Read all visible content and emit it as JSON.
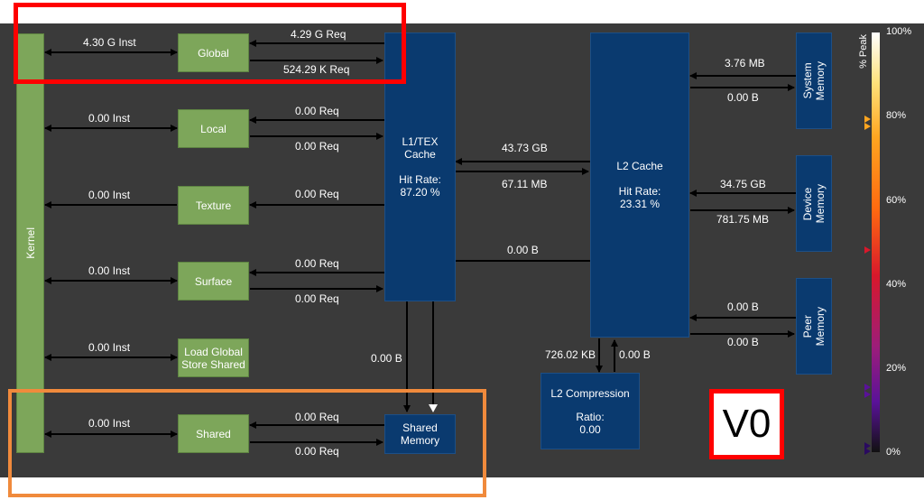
{
  "kernel": {
    "label": "Kernel"
  },
  "units": [
    {
      "key": "global",
      "label": "Global",
      "inst": "4.30 G Inst",
      "req_in": "4.29 G Req",
      "req_out": "524.29 K Req"
    },
    {
      "key": "local",
      "label": "Local",
      "inst": "0.00 Inst",
      "req_in": "0.00 Req",
      "req_out": "0.00 Req"
    },
    {
      "key": "texture",
      "label": "Texture",
      "inst": "0.00 Inst",
      "req_in": "0.00 Req"
    },
    {
      "key": "surface",
      "label": "Surface",
      "inst": "0.00 Inst",
      "req_in": "0.00 Req",
      "req_out": "0.00 Req"
    },
    {
      "key": "lgss",
      "label": "Load Global\nStore Shared",
      "inst": "0.00 Inst"
    },
    {
      "key": "shared",
      "label": "Shared",
      "inst": "0.00 Inst",
      "req_in": "0.00 Req",
      "req_out": "0.00 Req"
    }
  ],
  "l1": {
    "label": "L1/TEX\nCache",
    "hit_label": "Hit Rate:",
    "hit_rate": "87.20 %"
  },
  "shared_memory": {
    "label": "Shared\nMemory"
  },
  "l1_to_shared": "0.00 B",
  "l2": {
    "label": "L2 Cache",
    "hit_label": "Hit Rate:",
    "hit_rate": "23.31 %"
  },
  "l1_l2": {
    "read": "43.73 GB",
    "write": "67.11 MB",
    "l2_to_shared": "0.00 B"
  },
  "l2_compression": {
    "label": "L2 Compression",
    "ratio_label": "Ratio:",
    "ratio": "0.00",
    "in": "726.02 KB",
    "out": "0.00 B"
  },
  "system_memory": {
    "label": "System\nMemory",
    "read": "3.76 MB",
    "write": "0.00 B"
  },
  "device_memory": {
    "label": "Device\nMemory",
    "read": "34.75 GB",
    "write": "781.75 MB"
  },
  "peer_memory": {
    "label": "Peer\nMemory",
    "read": "0.00 B",
    "write": "0.00 B"
  },
  "scale": {
    "title": "% Peak",
    "ticks": [
      "100%",
      "80%",
      "60%",
      "40%",
      "20%",
      "0%"
    ]
  },
  "version_label": "V0",
  "colors": {
    "panel": "#3a3a3a",
    "unit_green": "#7da65a",
    "cache_blue": "#0a3a6f",
    "annotation_red": "#ff0000",
    "annotation_orange": "#f08a3c",
    "bus_purple": "#7a1fa0"
  }
}
